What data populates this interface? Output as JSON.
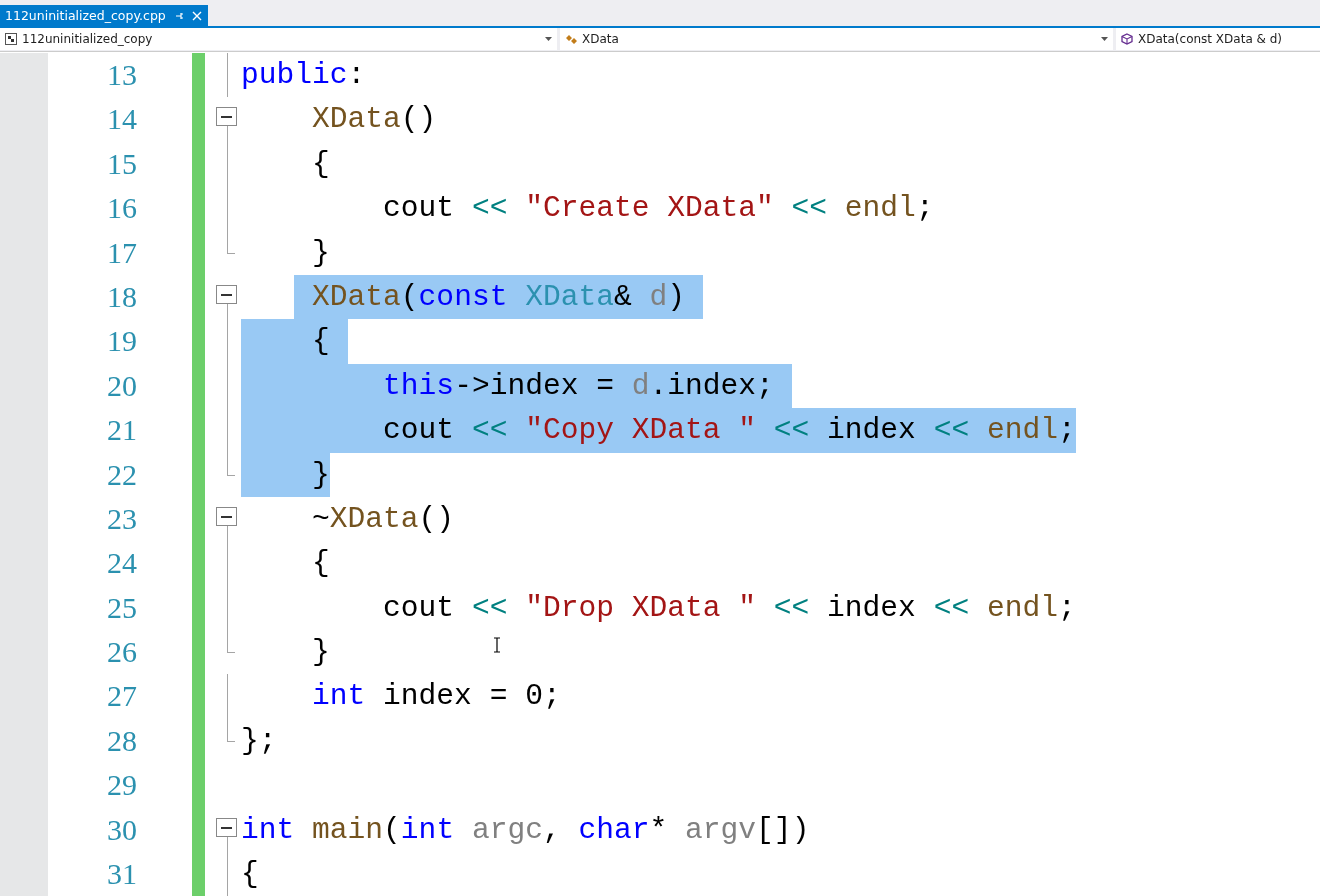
{
  "tab": {
    "label": "112uninitialized_copy.cpp",
    "selected": true
  },
  "nav_bar": [
    {
      "kind": "project",
      "label": "112uninitialized_copy"
    },
    {
      "kind": "class",
      "label": "XData"
    },
    {
      "kind": "member",
      "label": "XData(const XData & d)"
    }
  ],
  "lines": [
    {
      "number": "13",
      "changed": true,
      "kind": "inside",
      "tokens": [
        {
          "text": "public",
          "kind": "keyword",
          "selected": false
        },
        {
          "text": ":",
          "kind": "plain",
          "selected": false
        }
      ]
    },
    {
      "number": "14",
      "changed": true,
      "kind": "start",
      "expanded": true,
      "tokens": [
        {
          "text": "    XData",
          "kind": "function",
          "selected": false
        },
        {
          "text": "()",
          "kind": "plain",
          "selected": false
        }
      ]
    },
    {
      "number": "15",
      "changed": true,
      "kind": "inside",
      "tokens": [
        {
          "text": "    {",
          "kind": "plain",
          "selected": false
        }
      ]
    },
    {
      "number": "16",
      "changed": true,
      "kind": "inside",
      "tokens": [
        {
          "text": "        cout ",
          "kind": "plain",
          "selected": false
        },
        {
          "text": "<< ",
          "kind": "operator",
          "selected": false
        },
        {
          "text": "\"Create XData\" ",
          "kind": "string",
          "selected": false
        },
        {
          "text": "<< ",
          "kind": "operator",
          "selected": false
        },
        {
          "text": "endl",
          "kind": "function",
          "selected": false
        },
        {
          "text": ";",
          "kind": "plain",
          "selected": false
        }
      ]
    },
    {
      "number": "17",
      "changed": true,
      "kind": "end",
      "tokens": [
        {
          "text": "    }",
          "kind": "plain",
          "selected": false
        }
      ]
    },
    {
      "number": "18",
      "changed": true,
      "kind": "start",
      "expanded": true,
      "tokens": [
        {
          "text": "    XData",
          "kind": "function",
          "selected": true
        },
        {
          "text": "(",
          "kind": "plain",
          "selected": true
        },
        {
          "text": "const ",
          "kind": "keyword",
          "selected": true
        },
        {
          "text": "XData",
          "kind": "type",
          "selected": true
        },
        {
          "text": "& ",
          "kind": "plain",
          "selected": true
        },
        {
          "text": "d",
          "kind": "parameter",
          "selected": true
        },
        {
          "text": ") ",
          "kind": "plain",
          "selected": true
        }
      ]
    },
    {
      "number": "19",
      "changed": true,
      "kind": "inside",
      "tokens": [
        {
          "text": "    { ",
          "kind": "plain",
          "selected": true
        }
      ]
    },
    {
      "number": "20",
      "changed": true,
      "kind": "inside",
      "tokens": [
        {
          "text": "        this",
          "kind": "keyword",
          "selected": true
        },
        {
          "text": "->index = ",
          "kind": "plain",
          "selected": true
        },
        {
          "text": "d",
          "kind": "parameter",
          "selected": true
        },
        {
          "text": ".index; ",
          "kind": "plain",
          "selected": true
        }
      ]
    },
    {
      "number": "21",
      "changed": true,
      "kind": "inside",
      "tokens": [
        {
          "text": "        cout ",
          "kind": "plain",
          "selected": true
        },
        {
          "text": "<< ",
          "kind": "operator",
          "selected": true
        },
        {
          "text": "\"Copy XData \" ",
          "kind": "string",
          "selected": true
        },
        {
          "text": "<<",
          "kind": "operator",
          "selected": true
        },
        {
          "text": " index ",
          "kind": "plain",
          "selected": true
        },
        {
          "text": "<< ",
          "kind": "operator",
          "selected": true
        },
        {
          "text": "endl",
          "kind": "function",
          "selected": true
        },
        {
          "text": ";",
          "kind": "plain",
          "selected": true
        }
      ]
    },
    {
      "number": "22",
      "changed": true,
      "kind": "end",
      "tokens": [
        {
          "text": "    }",
          "kind": "plain",
          "selected": true
        }
      ]
    },
    {
      "number": "23",
      "changed": true,
      "kind": "start",
      "expanded": true,
      "tokens": [
        {
          "text": "    ~",
          "kind": "plain",
          "selected": false
        },
        {
          "text": "XData",
          "kind": "function",
          "selected": false
        },
        {
          "text": "()",
          "kind": "plain",
          "selected": false
        }
      ]
    },
    {
      "number": "24",
      "changed": true,
      "kind": "inside",
      "tokens": [
        {
          "text": "    {",
          "kind": "plain",
          "selected": false
        }
      ]
    },
    {
      "number": "25",
      "changed": true,
      "kind": "inside",
      "tokens": [
        {
          "text": "        cout ",
          "kind": "plain",
          "selected": false
        },
        {
          "text": "<< ",
          "kind": "operator",
          "selected": false
        },
        {
          "text": "\"Drop XData \" ",
          "kind": "string",
          "selected": false
        },
        {
          "text": "<<",
          "kind": "operator",
          "selected": false
        },
        {
          "text": " index ",
          "kind": "plain",
          "selected": false
        },
        {
          "text": "<< ",
          "kind": "operator",
          "selected": false
        },
        {
          "text": "endl",
          "kind": "function",
          "selected": false
        },
        {
          "text": ";",
          "kind": "plain",
          "selected": false
        }
      ]
    },
    {
      "number": "26",
      "changed": true,
      "kind": "end",
      "tokens": [
        {
          "text": "    }",
          "kind": "plain",
          "selected": false
        }
      ]
    },
    {
      "number": "27",
      "changed": true,
      "kind": "inside",
      "tokens": [
        {
          "text": "    int",
          "kind": "keyword",
          "selected": false
        },
        {
          "text": " index = 0;",
          "kind": "plain",
          "selected": false
        }
      ]
    },
    {
      "number": "28",
      "changed": true,
      "kind": "end",
      "tokens": [
        {
          "text": "};",
          "kind": "plain",
          "selected": false
        }
      ]
    },
    {
      "number": "29",
      "changed": true,
      "kind": "blank"
    },
    {
      "number": "30",
      "changed": true,
      "kind": "start",
      "expanded": true,
      "tokens": [
        {
          "text": "int ",
          "kind": "keyword",
          "selected": false
        },
        {
          "text": "main",
          "kind": "function",
          "selected": false
        },
        {
          "text": "(",
          "kind": "plain",
          "selected": false
        },
        {
          "text": "int ",
          "kind": "keyword",
          "selected": false
        },
        {
          "text": "argc",
          "kind": "parameter",
          "selected": false
        },
        {
          "text": ", ",
          "kind": "plain",
          "selected": false
        },
        {
          "text": "char",
          "kind": "keyword",
          "selected": false
        },
        {
          "text": "* ",
          "kind": "plain",
          "selected": false
        },
        {
          "text": "argv",
          "kind": "parameter",
          "selected": false
        },
        {
          "text": "[])",
          "kind": "plain",
          "selected": false
        }
      ]
    },
    {
      "number": "31",
      "changed": true,
      "kind": "inside",
      "tokens": [
        {
          "text": "{",
          "kind": "plain",
          "selected": false
        }
      ]
    }
  ]
}
